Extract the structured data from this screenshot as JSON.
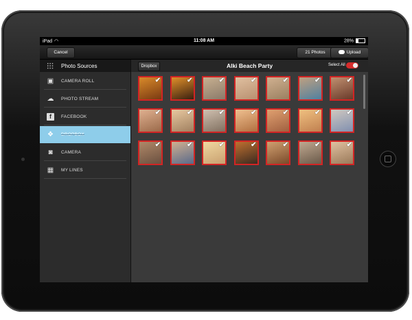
{
  "status_bar": {
    "device": "iPad",
    "time": "11:08 AM",
    "battery": "28%"
  },
  "toolbar": {
    "cancel_label": "Cancel",
    "photos_count_label": "21 Photos",
    "upload_label": "Upload"
  },
  "sidebar": {
    "title": "Photo Sources",
    "items": [
      {
        "label": "CAMERA ROLL",
        "icon": "image-icon"
      },
      {
        "label": "PHOTO STREAM",
        "icon": "cloud-icon"
      },
      {
        "label": "FACEBOOK",
        "icon": "facebook-icon"
      },
      {
        "label": "DROPBOX",
        "icon": "dropbox-icon",
        "selected": true
      },
      {
        "label": "CAMERA",
        "icon": "camera-icon"
      },
      {
        "label": "MY LINES",
        "icon": "layout-icon"
      }
    ]
  },
  "main": {
    "back_label": "Dropbox",
    "album_title": "Alki Beach Party",
    "select_all_label": "Select All",
    "select_all_on": true
  },
  "photos": {
    "count": 21,
    "all_selected": true,
    "thumb_colors": [
      [
        "#7a3a12",
        "#d98a2a"
      ],
      [
        "#3a2010",
        "#e0902a"
      ],
      [
        "#8a7a6a",
        "#c8b090"
      ],
      [
        "#b89070",
        "#e0c0a0"
      ],
      [
        "#9a8060",
        "#d0b090"
      ],
      [
        "#5080a0",
        "#c0a080"
      ],
      [
        "#6a3a2a",
        "#c09070"
      ],
      [
        "#9a6a4a",
        "#e0b090"
      ],
      [
        "#a08060",
        "#e8c8a0"
      ],
      [
        "#807060",
        "#d0c0b0"
      ],
      [
        "#b07040",
        "#f0c090"
      ],
      [
        "#a06040",
        "#e0a070"
      ],
      [
        "#c08050",
        "#f0c080"
      ],
      [
        "#8090b0",
        "#d0c8c0"
      ],
      [
        "#6a5040",
        "#b08868"
      ],
      [
        "#5a6a8a",
        "#d0b090"
      ],
      [
        "#c8a070",
        "#f0d8a0"
      ],
      [
        "#3a2a20",
        "#c07030"
      ],
      [
        "#7a4a2a",
        "#d0a070"
      ],
      [
        "#6a5a4a",
        "#c0a890"
      ],
      [
        "#9a7a5a",
        "#e0c0a0"
      ]
    ],
    "accent_color": "#d42424"
  }
}
